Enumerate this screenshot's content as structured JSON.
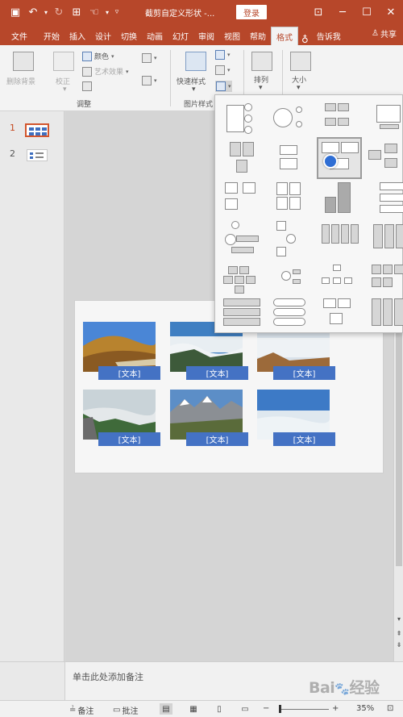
{
  "titlebar": {
    "title": "截剪自定义形状 -...",
    "login": "登录",
    "save_icon": "save-icon",
    "undo_icon": "undo-icon",
    "redo_icon": "redo-icon"
  },
  "tabs": [
    {
      "label": "文件"
    },
    {
      "label": "开始"
    },
    {
      "label": "插入"
    },
    {
      "label": "设计"
    },
    {
      "label": "切换"
    },
    {
      "label": "动画"
    },
    {
      "label": "幻灯"
    },
    {
      "label": "审阅"
    },
    {
      "label": "视图"
    },
    {
      "label": "帮助"
    },
    {
      "label": "格式"
    },
    {
      "label": "告诉我"
    }
  ],
  "share_label": "共享",
  "ribbon": {
    "remove_bg": "删除背景",
    "correct": "校正",
    "color": "颜色",
    "art_effect": "艺术效果",
    "adjust_group": "调整",
    "quick_style": "快速样式",
    "pic_style_group": "图片样式",
    "arrange": "排列",
    "size": "大小"
  },
  "thumbnails": [
    {
      "num": "1"
    },
    {
      "num": "2"
    }
  ],
  "captions": [
    "[文本]",
    "[文本]",
    "[文本]",
    "[文本]",
    "[文本]",
    "[文本]"
  ],
  "notes_placeholder": "单击此处添加备注",
  "status": {
    "notes": "备注",
    "comments": "批注",
    "zoom": "35%"
  },
  "watermark": "Bai经验",
  "colors": {
    "accent": "#b7472a",
    "caption": "#4472c4"
  }
}
